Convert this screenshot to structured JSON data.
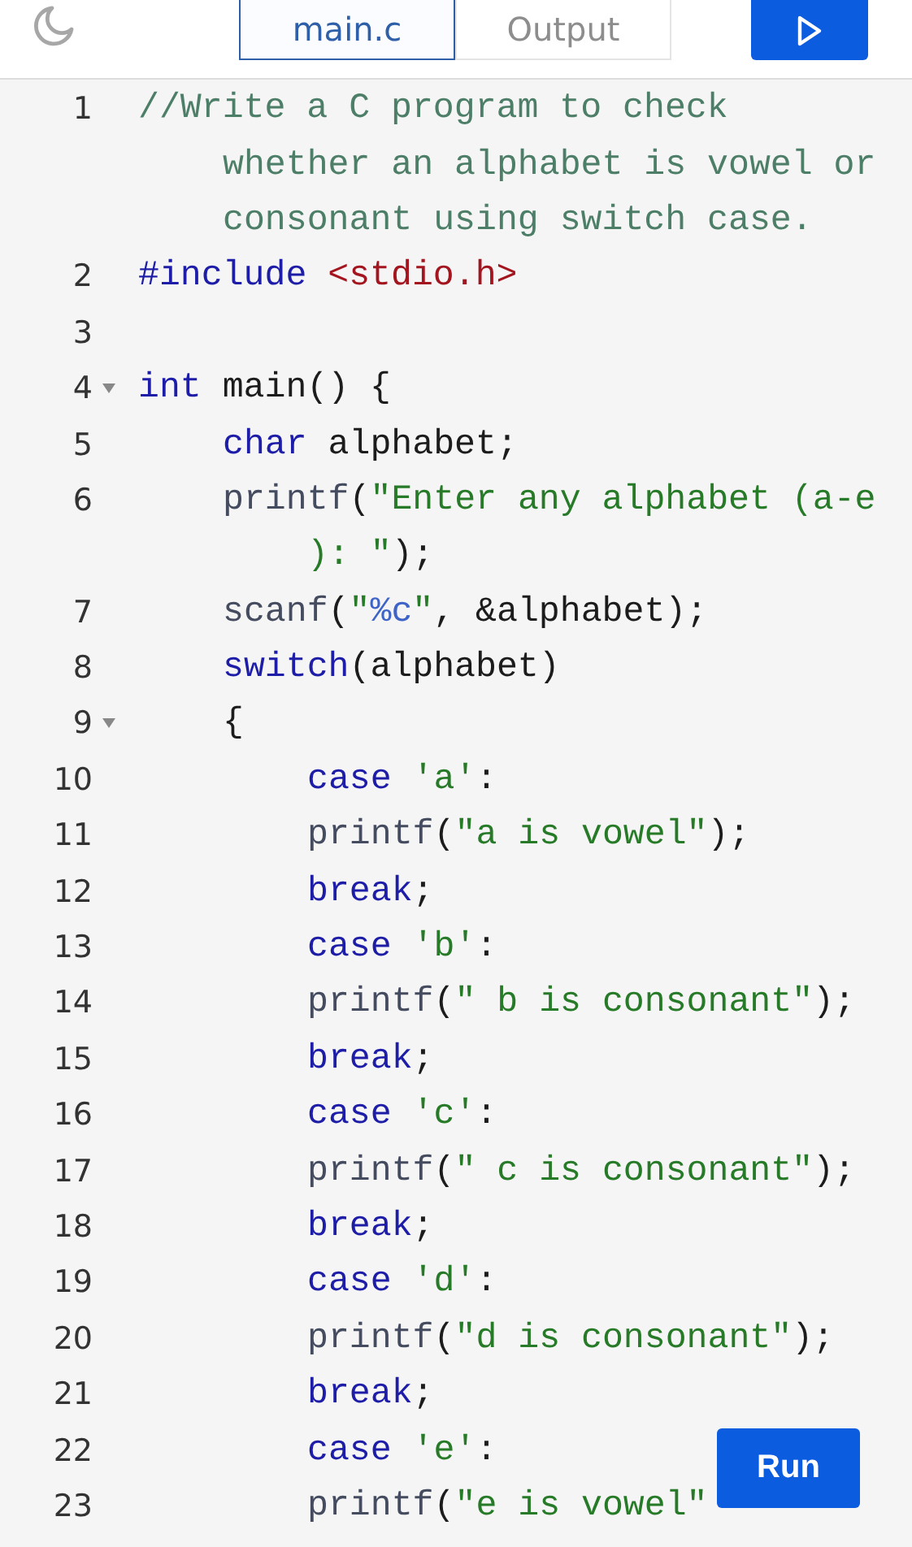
{
  "toolbar": {
    "tabs": [
      {
        "label": "main.c",
        "selected": true
      },
      {
        "label": "Output",
        "selected": false
      }
    ],
    "run_icon_button": {
      "kind": "play"
    }
  },
  "code": [
    {
      "number": "1",
      "segments": [
        {
          "tokens": [
            {
              "kind": "comment",
              "text": "//Write a C program to check"
            }
          ]
        },
        {
          "tokens": [
            {
              "kind": "comment",
              "text": "whether an alphabet is vowel or"
            }
          ]
        },
        {
          "tokens": [
            {
              "kind": "comment",
              "text": "consonant using switch case."
            }
          ]
        }
      ]
    },
    {
      "number": "2",
      "segments": [
        {
          "tokens": [
            {
              "kind": "keyword",
              "text": "#include"
            },
            {
              "kind": "include",
              "text": " <stdio.h>"
            }
          ]
        }
      ]
    },
    {
      "number": "3"
    },
    {
      "number": "4",
      "expanded": true,
      "segments": [
        {
          "tokens": [
            {
              "kind": "keyword",
              "text": "int"
            },
            {
              "kind": "plain",
              "text": " main() {"
            }
          ]
        }
      ],
      "children": [
        {
          "number": "5",
          "segments": [
            {
              "tokens": [
                {
                  "kind": "keyword",
                  "text": "char"
                },
                {
                  "kind": "plain",
                  "text": " alphabet;"
                }
              ]
            }
          ]
        },
        {
          "number": "6",
          "segments": [
            {
              "tokens": [
                {
                  "kind": "func",
                  "text": "printf"
                },
                {
                  "kind": "plain",
                  "text": "("
                },
                {
                  "kind": "string",
                  "text": "\"Enter any alphabet (a-e"
                }
              ]
            },
            {
              "tokens": [
                {
                  "kind": "string",
                  "text": "): \""
                },
                {
                  "kind": "plain",
                  "text": ");"
                }
              ]
            }
          ]
        },
        {
          "number": "7",
          "segments": [
            {
              "tokens": [
                {
                  "kind": "func",
                  "text": "scanf"
                },
                {
                  "kind": "plain",
                  "text": "("
                },
                {
                  "kind": "string",
                  "text": "\""
                },
                {
                  "kind": "format",
                  "text": "%c"
                },
                {
                  "kind": "string",
                  "text": "\""
                },
                {
                  "kind": "plain",
                  "text": ", &alphabet);"
                }
              ]
            }
          ]
        },
        {
          "number": "8",
          "segments": [
            {
              "tokens": [
                {
                  "kind": "keyword",
                  "text": "switch"
                },
                {
                  "kind": "plain",
                  "text": "(alphabet)"
                }
              ]
            }
          ]
        },
        {
          "number": "9",
          "expanded": true,
          "segments": [
            {
              "tokens": [
                {
                  "kind": "plain",
                  "text": "{"
                }
              ]
            }
          ],
          "children": [
            {
              "number": "10",
              "segments": [
                {
                  "tokens": [
                    {
                      "kind": "keyword",
                      "text": "case"
                    },
                    {
                      "kind": "string",
                      "text": " 'a'"
                    },
                    {
                      "kind": "plain",
                      "text": ":"
                    }
                  ]
                }
              ]
            },
            {
              "number": "11",
              "segments": [
                {
                  "tokens": [
                    {
                      "kind": "func",
                      "text": "printf"
                    },
                    {
                      "kind": "plain",
                      "text": "("
                    },
                    {
                      "kind": "string",
                      "text": "\"a is vowel\""
                    },
                    {
                      "kind": "plain",
                      "text": ");"
                    }
                  ]
                }
              ]
            },
            {
              "number": "12",
              "segments": [
                {
                  "tokens": [
                    {
                      "kind": "keyword",
                      "text": "break"
                    },
                    {
                      "kind": "plain",
                      "text": ";"
                    }
                  ]
                }
              ]
            },
            {
              "number": "13",
              "segments": [
                {
                  "tokens": [
                    {
                      "kind": "keyword",
                      "text": "case"
                    },
                    {
                      "kind": "string",
                      "text": " 'b'"
                    },
                    {
                      "kind": "plain",
                      "text": ":"
                    }
                  ]
                }
              ]
            },
            {
              "number": "14",
              "segments": [
                {
                  "tokens": [
                    {
                      "kind": "func",
                      "text": "printf"
                    },
                    {
                      "kind": "plain",
                      "text": "("
                    },
                    {
                      "kind": "string",
                      "text": "\" b is consonant\""
                    },
                    {
                      "kind": "plain",
                      "text": ");"
                    }
                  ]
                }
              ]
            },
            {
              "number": "15",
              "segments": [
                {
                  "tokens": [
                    {
                      "kind": "keyword",
                      "text": "break"
                    },
                    {
                      "kind": "plain",
                      "text": ";"
                    }
                  ]
                }
              ]
            },
            {
              "number": "16",
              "segments": [
                {
                  "tokens": [
                    {
                      "kind": "keyword",
                      "text": "case"
                    },
                    {
                      "kind": "string",
                      "text": " 'c'"
                    },
                    {
                      "kind": "plain",
                      "text": ":"
                    }
                  ]
                }
              ]
            },
            {
              "number": "17",
              "segments": [
                {
                  "tokens": [
                    {
                      "kind": "func",
                      "text": "printf"
                    },
                    {
                      "kind": "plain",
                      "text": "("
                    },
                    {
                      "kind": "string",
                      "text": "\" c is consonant\""
                    },
                    {
                      "kind": "plain",
                      "text": ");"
                    }
                  ]
                }
              ]
            },
            {
              "number": "18",
              "segments": [
                {
                  "tokens": [
                    {
                      "kind": "keyword",
                      "text": "break"
                    },
                    {
                      "kind": "plain",
                      "text": ";"
                    }
                  ]
                }
              ]
            },
            {
              "number": "19",
              "segments": [
                {
                  "tokens": [
                    {
                      "kind": "keyword",
                      "text": "case"
                    },
                    {
                      "kind": "string",
                      "text": " 'd'"
                    },
                    {
                      "kind": "plain",
                      "text": ":"
                    }
                  ]
                }
              ]
            },
            {
              "number": "20",
              "segments": [
                {
                  "tokens": [
                    {
                      "kind": "func",
                      "text": "printf"
                    },
                    {
                      "kind": "plain",
                      "text": "("
                    },
                    {
                      "kind": "string",
                      "text": "\"d is consonant\""
                    },
                    {
                      "kind": "plain",
                      "text": ");"
                    }
                  ]
                }
              ]
            },
            {
              "number": "21",
              "segments": [
                {
                  "tokens": [
                    {
                      "kind": "keyword",
                      "text": "break"
                    },
                    {
                      "kind": "plain",
                      "text": ";"
                    }
                  ]
                }
              ]
            },
            {
              "number": "22",
              "segments": [
                {
                  "tokens": [
                    {
                      "kind": "keyword",
                      "text": "case"
                    },
                    {
                      "kind": "string",
                      "text": " 'e'"
                    },
                    {
                      "kind": "plain",
                      "text": ":"
                    }
                  ]
                }
              ]
            },
            {
              "number": "23",
              "segments": [
                {
                  "tokens": [
                    {
                      "kind": "func",
                      "text": "printf"
                    },
                    {
                      "kind": "plain",
                      "text": "("
                    },
                    {
                      "kind": "string",
                      "text": "\"e is vowel\""
                    }
                  ]
                }
              ]
            }
          ]
        }
      ]
    }
  ],
  "run_button": {
    "label": "Run"
  }
}
